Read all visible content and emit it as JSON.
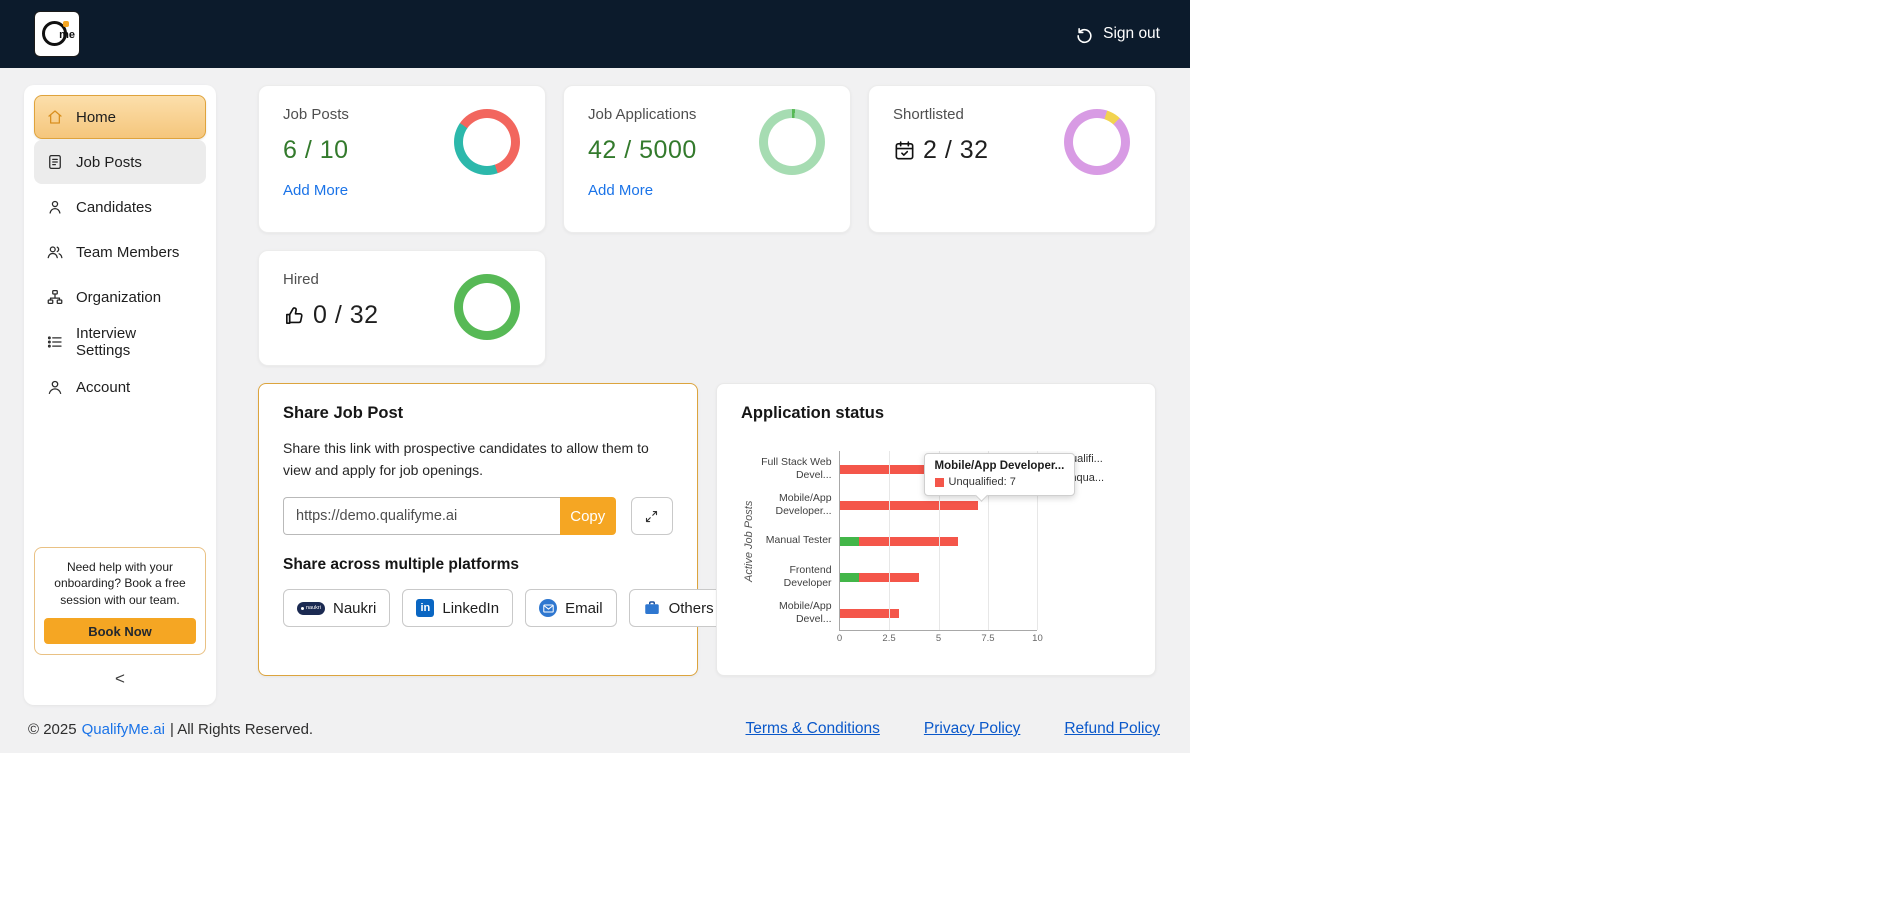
{
  "navbar": {
    "logo_me": "me",
    "sign_out_label": "Sign out"
  },
  "sidebar": {
    "items": [
      {
        "label": "Home"
      },
      {
        "label": "Job Posts"
      },
      {
        "label": "Candidates"
      },
      {
        "label": "Team Members"
      },
      {
        "label": "Organization"
      },
      {
        "label": "Interview Settings"
      },
      {
        "label": "Account"
      }
    ],
    "help_box": {
      "text": "Need help with your onboarding? Book a free session with our team.",
      "button_label": "Book Now"
    },
    "collapse_label": "<"
  },
  "stat_cards": [
    {
      "title": "Job Posts",
      "value": "6 / 10",
      "value_color": "#337a2c",
      "link_label": "Add More",
      "donut": {
        "from": -55,
        "segments": [
          {
            "color": "#f2665e",
            "pct": 60
          },
          {
            "color": "#2cb8ab",
            "pct": 40
          }
        ]
      }
    },
    {
      "title": "Job Applications",
      "value": "42 / 5000",
      "value_color": "#337a2c",
      "link_label": "Add More",
      "donut": {
        "from": 0,
        "segments": [
          {
            "color": "#57b956",
            "pct": 1.5
          },
          {
            "color": "#a6dcb2",
            "pct": 98.5
          }
        ]
      }
    },
    {
      "title": "Shortlisted",
      "value": "2 / 32",
      "value_color": "#1f1f1f",
      "icon": "calendar-check-icon",
      "donut": {
        "from": 18,
        "segments": [
          {
            "color": "#f2d34f",
            "pct": 7
          },
          {
            "color": "#d89be4",
            "pct": 93
          }
        ]
      }
    },
    {
      "title": "Hired",
      "value": "0 / 32",
      "value_color": "#1f1f1f",
      "icon": "thumbs-up-icon",
      "donut": {
        "from": 0,
        "segments": [
          {
            "color": "#57b956",
            "pct": 100
          }
        ]
      }
    }
  ],
  "share_card": {
    "title": "Share Job Post",
    "description": "Share this link with prospective candidates to allow them to view and apply for job openings.",
    "url_value": "https://demo.qualifyme.ai",
    "copy_label": "Copy",
    "platforms_heading": "Share across multiple platforms",
    "platforms": [
      {
        "label": "Naukri",
        "icon": "naukri-icon"
      },
      {
        "label": "LinkedIn",
        "icon": "linkedin-icon"
      },
      {
        "label": "Email",
        "icon": "email-icon"
      },
      {
        "label": "Others",
        "icon": "briefcase-icon"
      }
    ]
  },
  "chart_data": {
    "type": "bar",
    "orientation": "horizontal",
    "stacked": true,
    "title": "Application status",
    "ylabel": "Active Job Posts",
    "xlim": [
      0,
      10
    ],
    "xticks": [
      0,
      2.5,
      5,
      7.5,
      10
    ],
    "grid": true,
    "legend_position": "top-right",
    "categories": [
      "Full Stack Web\nDevel...",
      "Mobile/App\nDeveloper...",
      "Manual Tester",
      "Frontend\nDeveloper",
      "Mobile/App\nDevel..."
    ],
    "series": [
      {
        "key": "qualified",
        "name": "Qualifi...",
        "color": "#43b649",
        "values": [
          0,
          0,
          1,
          1,
          0
        ]
      },
      {
        "key": "unqualified",
        "name": "Unqua...",
        "color": "#f4564a",
        "values": [
          5,
          7,
          5,
          3,
          3
        ]
      }
    ],
    "tooltip": {
      "title": "Mobile/App Developer...",
      "label": "Unqualified: 7",
      "color": "#f4564a"
    }
  },
  "footer": {
    "copyright_prefix": "© 2025",
    "brand_link": "QualifyMe.ai",
    "copyright_suffix": "| All Rights Reserved.",
    "links": [
      {
        "label": "Terms & Conditions"
      },
      {
        "label": "Privacy Policy"
      },
      {
        "label": "Refund Policy"
      }
    ]
  },
  "colors": {
    "navbar_bg": "#0c1b2c",
    "accent_orange": "#f5a623",
    "sidebar_active": "#f6c87d",
    "link_blue": "#1a73e8",
    "chart_green": "#43b649",
    "chart_red": "#f4564a"
  }
}
